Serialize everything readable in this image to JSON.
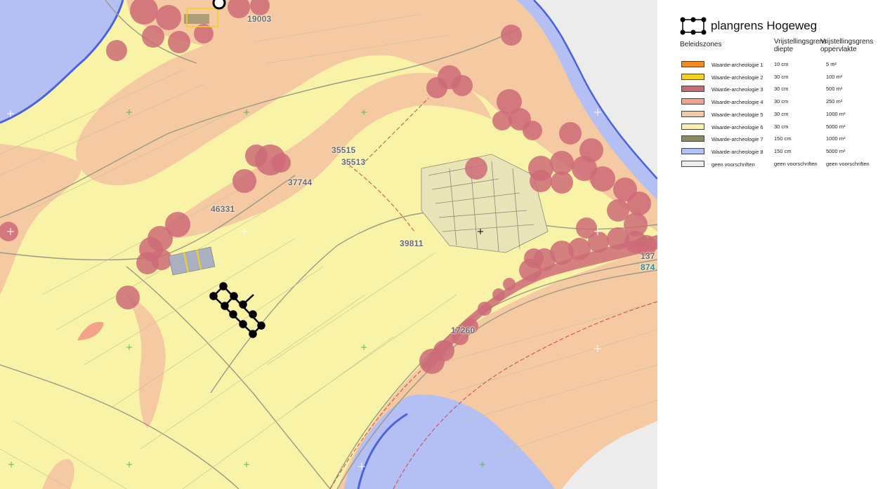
{
  "legend": {
    "title": "plangrens Hogeweg",
    "section_heading": "Beleidszones",
    "col_depth": "Vrijstellingsgrens diepte",
    "col_area": "Vrijstellingsgrens oppervlakte",
    "items": [
      {
        "name": "Waarde-archeologie 1",
        "depth": "10 cm",
        "area": "5 m²",
        "color": "#f28c1e"
      },
      {
        "name": "Waarde-archeologie 2",
        "depth": "30 cm",
        "area": "100 m²",
        "color": "#f5d21a"
      },
      {
        "name": "Waarde-archeologie 3",
        "depth": "30 cm",
        "area": "500 m²",
        "color": "#cc6b78"
      },
      {
        "name": "Waarde-archeologie 4",
        "depth": "30 cm",
        "area": "250 m²",
        "color": "#f2a48a"
      },
      {
        "name": "Waarde-archeologie 5",
        "depth": "30 cm",
        "area": "1000 m²",
        "color": "#f5c9a2"
      },
      {
        "name": "Waarde-archeologie 6",
        "depth": "30 cm",
        "area": "5000 m²",
        "color": "#f9f3a8"
      },
      {
        "name": "Waarde-archeologie 7",
        "depth": "150 cm",
        "area": "1000 m²",
        "color": "#8e8a66"
      },
      {
        "name": "Waarde-archeologie 8",
        "depth": "150 cm",
        "area": "5000 m²",
        "color": "#b4bff3"
      },
      {
        "name": "geen voorschriften",
        "depth": "geen voorschriften",
        "area": "geen voorschriften",
        "color": "#ececec"
      }
    ]
  },
  "map": {
    "labels": [
      {
        "id": "19003",
        "text": "19003"
      },
      {
        "id": "35515",
        "text": "35515"
      },
      {
        "id": "35513",
        "text": "35513"
      },
      {
        "id": "37744",
        "text": "37744"
      },
      {
        "id": "46331",
        "text": "46331"
      },
      {
        "id": "39811",
        "text": "39811"
      },
      {
        "id": "17260",
        "text": "17260"
      },
      {
        "id": "137",
        "text": "137"
      },
      {
        "id": "874",
        "text": "874"
      }
    ]
  }
}
